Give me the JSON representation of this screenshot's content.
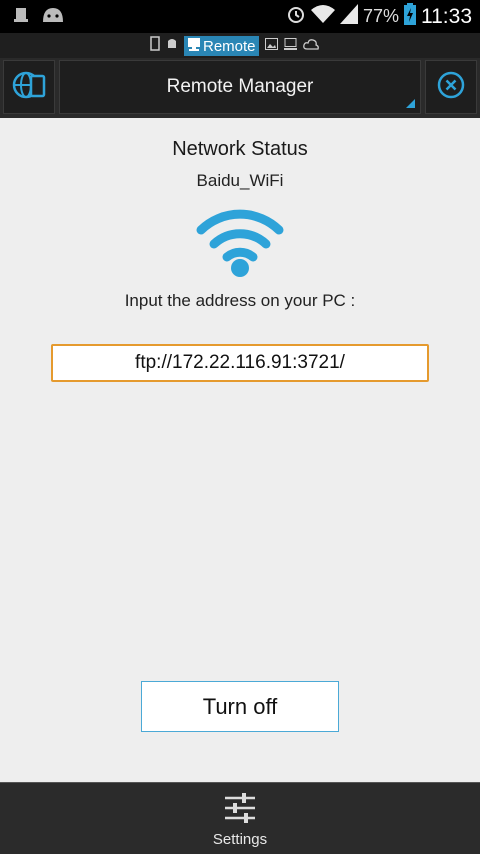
{
  "status_bar": {
    "battery_percent": "77%",
    "time": "11:33",
    "icons": [
      "notification-icon",
      "android-icon",
      "alarm-icon",
      "wifi-signal-icon",
      "cell-signal-icon",
      "battery-charging-icon"
    ]
  },
  "tab_strip": {
    "active_tab_label": "Remote",
    "icons": [
      "phone-icon",
      "android-icon",
      "remote-icon",
      "image-icon",
      "computer-icon",
      "cloud-icon"
    ]
  },
  "toolbar": {
    "title": "Remote Manager",
    "left_icon": "globe-phone-icon",
    "right_icon": "close-circle-icon"
  },
  "main": {
    "heading": "Network Status",
    "network_name": "Baidu_WiFi",
    "hint": "Input the address on your PC :",
    "address": "ftp://172.22.116.91:3721/",
    "turn_off_label": "Turn off"
  },
  "bottom_bar": {
    "settings_label": "Settings",
    "settings_icon": "sliders-icon"
  },
  "colors": {
    "accent_blue": "#2ea3d9",
    "address_border": "#e59a2e",
    "toolbar_bg": "#2a2a2a",
    "content_bg": "#eeeeee"
  }
}
